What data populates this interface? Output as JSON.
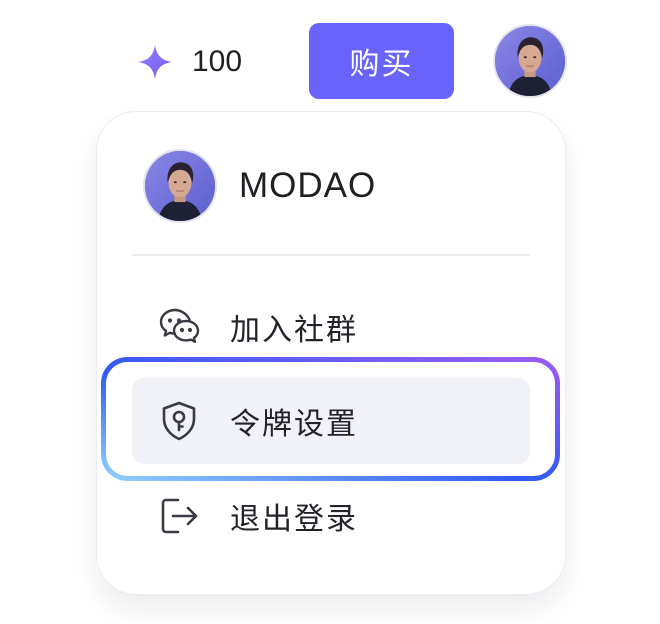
{
  "header": {
    "credits_icon": "sparkle-icon",
    "credits_value": "100",
    "buy_label": "购买",
    "avatar": "user-avatar"
  },
  "menu": {
    "username": "MODAO",
    "items": [
      {
        "label": "加入社群",
        "icon": "wechat-icon",
        "active": false
      },
      {
        "label": "令牌设置",
        "icon": "shield-key-icon",
        "active": true
      },
      {
        "label": "退出登录",
        "icon": "logout-icon",
        "active": false
      }
    ]
  },
  "colors": {
    "primary": "#6763fb",
    "sparkle": "#8a6cf5",
    "active_bg": "#f1f2f7",
    "focus_gradient": [
      "#8fd0ff",
      "#2f5bf1",
      "#9a5cf3"
    ]
  }
}
